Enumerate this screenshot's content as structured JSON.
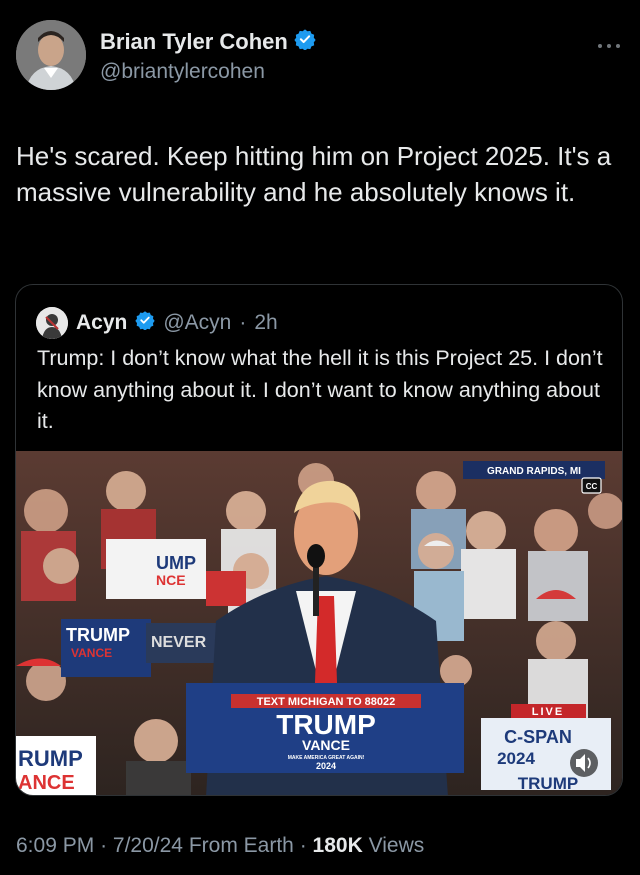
{
  "author": {
    "name": "Brian Tyler Cohen",
    "handle": "@briantylercohen",
    "verified": true,
    "badge_color": "#1d9bf0"
  },
  "more_menu_icon": "more-options-icon",
  "tweet": {
    "text": "He's scared. Keep hitting him on Project 2025. It's a massive vulnerability and he absolutely knows it."
  },
  "quote": {
    "name": "Acyn",
    "handle": "@Acyn",
    "time": "2h",
    "separator": "·",
    "text": "Trump: I don’t know what the hell it is this Project 25. I don’t know anything about it. I don’t want to know anything about it."
  },
  "video": {
    "location_chyron": "GRAND RAPIDS, MI",
    "cc_label": "CC",
    "podium_text_line": "TEXT MICHIGAN TO 88022",
    "podium_trump": "TRUMP",
    "podium_vance": "VANCE",
    "podium_slogan": "MAKE AMERICA GREAT AGAIN!",
    "podium_year": "2024",
    "live_label": "LIVE",
    "network": "C-SPAN",
    "network_year": "2024",
    "sign_left_trump": "TRUMP",
    "sign_left_vance": "VANCE",
    "sign_left_bottom_1": "RUMP",
    "sign_left_bottom_2": "ANCE",
    "sign_never": "NEVER",
    "sign_ump": "UMP",
    "sign_nce": "NCE",
    "sign_right_trump": "TRUMP",
    "mute_icon": "volume-icon"
  },
  "footer": {
    "time": "6:09 PM",
    "date": "7/20/24",
    "source": "From Earth",
    "views_count": "180K",
    "views_label": "Views",
    "separator": "·"
  }
}
